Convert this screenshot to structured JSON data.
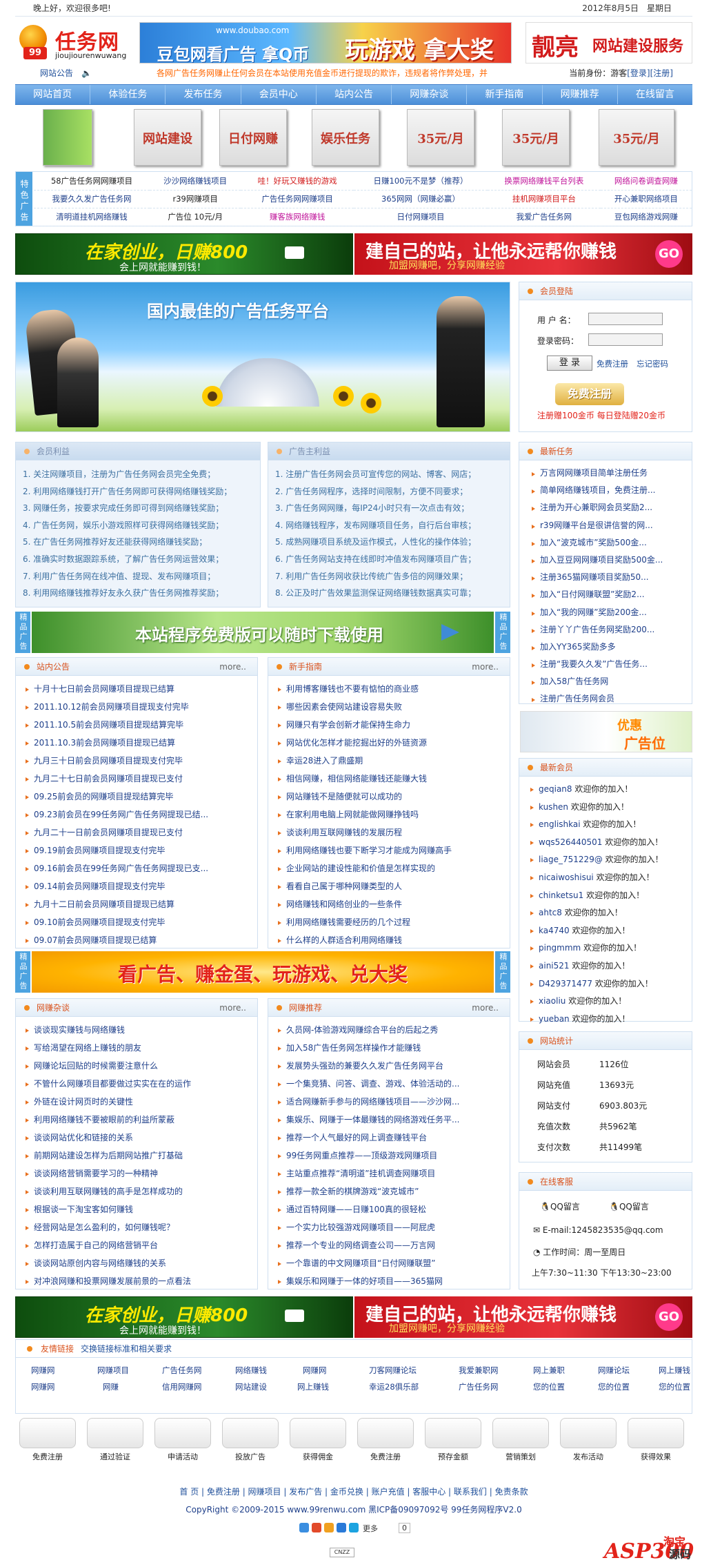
{
  "topbar": {
    "greeting": "晚上好，欢迎很多吧!",
    "date": "2012年8月5日　星期日"
  },
  "logo": {
    "badge": "99",
    "name": "任务网",
    "sub": "jioujiourenwuwang"
  },
  "ads": {
    "top_url": "www.doubao.com",
    "top_a": "豆包网看广告 拿Q币",
    "top_b": "玩游戏 拿大奖",
    "right_a": "靓亮",
    "right_b": "网站建设服务",
    "green_a": "在家创业，日赚800",
    "green_b": "会上网就能赚到钱！",
    "red_a": "建自己的站，让他永远帮你赚钱",
    "red_b": "加盟网赚吧，分享网赚经验",
    "go": "GO"
  },
  "notice": {
    "label": "网站公告",
    "marquee": "各网广告任务网赚止任何会员在本站使用充值金币进行提现的欺诈，违规者将作弊处理，并",
    "identity": "当前身份：游客",
    "login": "[登录]",
    "register": "[注册]"
  },
  "nav": [
    "网站首页",
    "体验任务",
    "发布任务",
    "会员中心",
    "站内公告",
    "网赚杂谈",
    "新手指南",
    "网赚推荐",
    "在线留言"
  ],
  "thumbs": [
    "网站建设",
    "日付网赚",
    "娱乐任务",
    "35元/月",
    "35元/月",
    "35元/月"
  ],
  "special": {
    "label": "特色广告",
    "rows": [
      [
        "58广告任务网网赚项目",
        "沙沙网络赚钱项目",
        "哇！好玩又赚钱的游戏",
        "日赚100元不是梦（推荐）",
        "换票网络赚钱平台列表",
        "网络问卷调查网赚"
      ],
      [
        "我要久久发广告任务网",
        "r39网赚项目",
        "广告任务网网赚项目",
        "365网网（网赚必赢）",
        "挂机网赚项目平台",
        "开心兼职网络项目"
      ],
      [
        "清明道挂机网络赚钱",
        "广告位 10元/月",
        "赚客族网络赚钱",
        "日付网赚项目",
        "我爱广告任务网",
        "豆包网络游戏网赚"
      ]
    ]
  },
  "hero": {
    "title": "国内最佳的广告任务平台"
  },
  "member_benefits": {
    "title": "会员利益",
    "items": [
      "1. 关注网赚项目，注册为广告任务网会员完全免费；",
      "2. 利用网络赚钱打开广告任务网即可获得网络赚钱奖励；",
      "3. 网赚任务，按要求完成任务即可得到网络赚钱奖励；",
      "4. 广告任务网，娱乐小游戏照样可获得网络赚钱奖励；",
      "5. 在广告任务网推荐好友还能获得网络赚钱奖励；",
      "6. 准确实时数据跟踪系统，了解广告任务网运营效果；",
      "7. 利用广告任务网在线冲值、提现、发布网赚项目；",
      "8. 利用网络赚钱推荐好友永久获广告任务网推荐奖励；"
    ]
  },
  "advertiser_benefits": {
    "title": "广告主利益",
    "items": [
      "1. 注册广告任务网会员可宣传您的网站、博客、网店；",
      "2. 广告任务网程序，选择时间限制，方便不同要求；",
      "3. 广告任务网网赚，每IP24小时只有一次点击有效；",
      "4. 网络赚钱程序，发布网赚项目任务，自行后台审核；",
      "5. 成熟网赚项目系统及运作模式，人性化的操作体验；",
      "6. 广告任务网站支持在线即时冲值发布网赚项目广告；",
      "7. 利用广告任务网收获比传统广告多倍的网赚效果；",
      "8. 公正及时广告效果监测保证网络赚钱数据真实可靠；"
    ]
  },
  "bars": {
    "side": "精品广告",
    "green": "本站程序免费版可以随时下载使用",
    "orange": "看广告、赚金蛋、玩游戏、兑大奖"
  },
  "more": "more..",
  "site_notice": {
    "title": "站内公告",
    "items": [
      "十月十七日前会员网赚项目提现已结算",
      "2011.10.12前会员网赚项目提现支付完毕",
      "2011.10.5前会员网赚项目提现结算完毕",
      "2011.10.3前会员网赚项目提现已结算",
      "九月三十日前会员网赚项目提现支付完毕",
      "九月二十七日前会员网赚项目提现已支付",
      "09.25前会员的网赚项目提现结算完毕",
      "09.23前会员在99任务网广告任务网提现已结...",
      "九月二十一日前会员网赚项目提现已支付",
      "09.19前会员网赚项目提现支付完毕",
      "09.16前会员在99任务网广告任务网提现已支...",
      "09.14前会员网赚项目提现支付完毕",
      "九月十二日前会员网赚项目提现已结算",
      "09.10前会员网赚项目提现支付完毕",
      "09.07前会员网赚项目提现已结算"
    ]
  },
  "guide": {
    "title": "新手指南",
    "items": [
      "利用博客赚钱也不要有惦怕的商业感",
      "哪些因素会使网站建设容易失败",
      "网赚只有学会创新才能保持生命力",
      "网站优化怎样才能挖掘出好的外链资源",
      "幸运28进入了鼎盛期",
      "相信网赚，相信网络能赚钱还能赚大钱",
      "网站赚钱不是随便就可以成功的",
      "在家利用电脑上网就能做网赚挣钱吗",
      "谈谈利用互联网赚钱的发展历程",
      "利用网络赚钱也要下断学习才能成为网赚高手",
      "企业网站的建设性能和价值是怎样实现的",
      "看看自己属于哪种网赚类型的人",
      "网络赚钱和网络创业的一些条件",
      "利用网络赚钱需要经历的几个过程",
      "什么样的人群适合利用网络赚钱"
    ]
  },
  "talk": {
    "title": "网赚杂谈",
    "items": [
      "谈谈现实赚钱与网络赚钱",
      "写给渴望在网络上赚钱的朋友",
      "网赚论坛回贴的时候需要注意什么",
      "不管什么网赚项目都要做过实实在在的运作",
      "外链在设计网页时的关键性",
      "利用网络赚钱不要被眼前的利益所蒙蔽",
      "谈谈网站优化和链接的关系",
      "前期网站建设怎样为后期网站推广打基础",
      "谈谈网络营销需要学习的一种精神",
      "谈谈利用互联网赚钱的高手是怎样成功的",
      "根据谈一下淘宝客如何赚钱",
      "经营网站是怎么盈利的，如何赚钱呢？",
      "怎样打造属于自己的网络营销平台",
      "谈谈网站原创内容与网络赚钱的关系",
      "对冲浪网赚和投票网赚发展前景的一点看法"
    ]
  },
  "recommend": {
    "title": "网赚推荐",
    "items": [
      "久员网-体验游戏网赚综合平台的后起之秀",
      "加入58广告任务网怎样操作才能赚钱",
      "发展势头强劲的兼要久久发广告任务网平台",
      "一个集竞猜、问答、调查、游戏、体验活动的...",
      "适合网赚新手参与的网络赚钱项目——沙沙网...",
      "集娱乐、网赚于一体最赚钱的网络游戏任务平...",
      "推荐一个人气最好的网上调查赚钱平台",
      "99任务网重点推荐——顶级游戏网赚项目",
      "主站重点推荐“清明道”挂机调查网赚项目",
      "推荐一款全新的棋牌游戏“波克城市”",
      "通过百特网赚——日赚100真的很轻松",
      "一个实力比较强游戏网赚项目——阿屁虎",
      "推荐一个专业的网络调查公司——万言网",
      "一个靠谱的中文网赚项目“日付网赚联盟”",
      "集娱乐和网赚于一体的好项目——365猫网"
    ]
  },
  "login": {
    "title": "会员登陆",
    "user_label": "用 户 名：",
    "pass_label": "登录密码：",
    "submit": "登 录",
    "register": "免费注册",
    "forgot": "忘记密码",
    "big_register": "免费注册",
    "bonus": "注册赠100金币 每日登陆赠20金币"
  },
  "latest_tasks": {
    "title": "最新任务",
    "items": [
      "万言网网赚项目简单注册任务",
      "简单网络赚钱项目，免费注册...",
      "注册为开心兼职网会员奖励2...",
      "r39网赚平台是很讲信誉的网...",
      "加入“波克城市”奖励500金...",
      "加入豆豆网网赚项目奖励500金...",
      "注册365猫网赚项目奖励50...",
      "加入“日付网赚联盟”奖励2...",
      "加入“我的网赚”奖励200金...",
      "注册丫丫广告任务网奖励200...",
      "加入YY365奖励多多",
      "注册“我要久久发”广告任务...",
      "加入58广告任务网",
      "注册广告任务网会员"
    ]
  },
  "promo": {
    "a": "优惠",
    "b": "广告位"
  },
  "latest_members": {
    "title": "最新会员",
    "welcome": "欢迎你的加入！",
    "names": [
      "geqian8",
      "kushen",
      "englishkai",
      "wqs526440501",
      "liage_751229@",
      "nicaiwoshisui",
      "chinketsu1",
      "ahtc8",
      "ka4740",
      "pingmmm",
      "aini521",
      "D429371477",
      "xiaoliu",
      "yueban"
    ]
  },
  "stats": {
    "title": "网站统计",
    "rows": [
      {
        "k": "网站会员",
        "v": "1126位"
      },
      {
        "k": "网站充值",
        "v": "13693元"
      },
      {
        "k": "网站支付",
        "v": "6903.803元"
      },
      {
        "k": "充值次数",
        "v": "共5962笔"
      },
      {
        "k": "支付次数",
        "v": "共11499笔"
      }
    ]
  },
  "service": {
    "title": "在线客服",
    "qq1": "QQ留言",
    "qq2": "QQ留言",
    "email": "E-mail:1245823535@qq.com",
    "hours_label": "工作时间：周一至周日",
    "hours": "上午7:30~11:30 下午13:30~23:00"
  },
  "friend_links": {
    "title": "友情链接",
    "exchange": "交换链接标准和相关要求",
    "row1": [
      "网赚网",
      "网赚项目",
      "广告任务网",
      "网络赚钱",
      "网赚网",
      "刀客网赚论坛",
      "我爱兼职网",
      "网上兼职",
      "网赚论坛",
      "网上赚钱"
    ],
    "row2": [
      "网赚网",
      "网赚",
      "信用网赚网",
      "网站建设",
      "网上赚钱",
      "幸运28俱乐部",
      "广告任务网",
      "您的位置",
      "您的位置",
      "您的位置"
    ]
  },
  "process": [
    "免费注册",
    "通过验证",
    "申请活动",
    "投放广告",
    "获得佣金",
    "免费注册",
    "预存金额",
    "营销策划",
    "发布活动",
    "获得效果"
  ],
  "footer": {
    "links": "首 页 | 免费注册 | 网赚项目 | 发布广告 | 金币兑换 | 账户充值 | 客服中心 | 联系我们 | 免责条款",
    "copyright": "CopyRight ©2009-2015 www.99renwu.com 黑ICP备09097092号 99任务网程序V2.0",
    "more": "更多",
    "count": "0",
    "cnzz": "CNZZ"
  },
  "watermark": {
    "a": "ASP300",
    "b": "源码",
    "c": "淘宝"
  }
}
